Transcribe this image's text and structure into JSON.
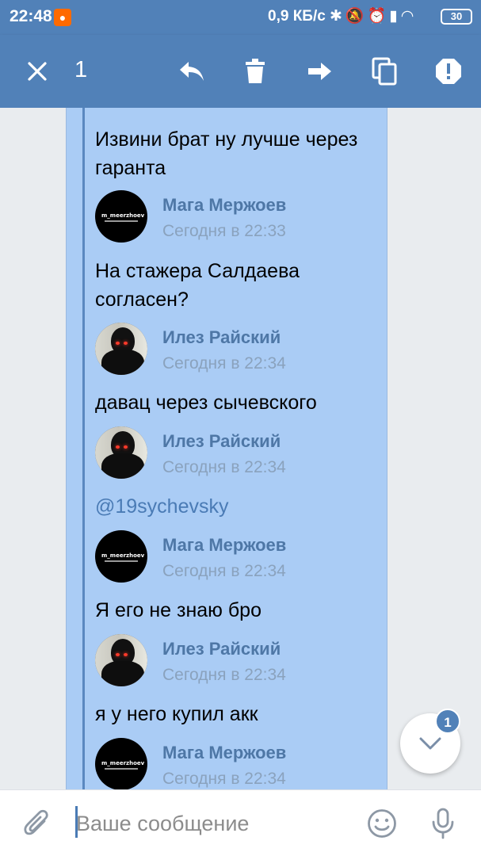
{
  "status_bar": {
    "time": "22:48",
    "network_speed": "0,9 КБ/с",
    "battery": "30"
  },
  "toolbar": {
    "selected_count": "1"
  },
  "messages": [
    {
      "kind": "text",
      "text": "Извини брат ну лучше через гаранта"
    },
    {
      "kind": "author",
      "name": "Мага Мержоев",
      "time": "Сегодня в 22:33",
      "avatar": "m_meerzhoev-logo"
    },
    {
      "kind": "text",
      "text": "На стажера Салдаева согласен?"
    },
    {
      "kind": "author",
      "name": "Илез Райский",
      "time": "Сегодня в 22:34",
      "avatar": "hooded-figure"
    },
    {
      "kind": "text",
      "text": "давац через сычевского"
    },
    {
      "kind": "author",
      "name": "Илез Райский",
      "time": "Сегодня в 22:34",
      "avatar": "hooded-figure"
    },
    {
      "kind": "link",
      "text": "@19sychevsky"
    },
    {
      "kind": "author",
      "name": "Мага Мержоев",
      "time": "Сегодня в 22:34",
      "avatar": "m_meerzhoev-logo"
    },
    {
      "kind": "text",
      "text": "Я его не знаю бро"
    },
    {
      "kind": "author",
      "name": "Илез Райский",
      "time": "Сегодня в 22:34",
      "avatar": "hooded-figure"
    },
    {
      "kind": "text",
      "text": "я у него купил акк"
    },
    {
      "kind": "author",
      "name": "Мага Мержоев",
      "time": "Сегодня в 22:34",
      "avatar": "m_meerzhoev-logo"
    }
  ],
  "avatar_logo_text": "m_meerzhoev",
  "scroll_down": {
    "unread_count": "1"
  },
  "composer": {
    "placeholder": "Ваше сообщение"
  },
  "colors": {
    "accent": "#5181b8",
    "selection": "#aaccf5",
    "author_name": "#4e77a6"
  }
}
